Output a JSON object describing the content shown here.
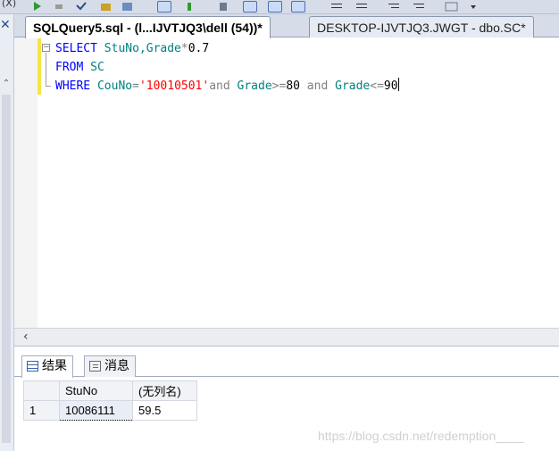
{
  "toolbar": {
    "fragment": "(X)"
  },
  "tabs": [
    {
      "label": "SQLQuery5.sql - (l...IJVTJQ3\\dell (54))*",
      "active": true
    },
    {
      "label": "DESKTOP-IJVTJQ3.JWGT - dbo.SC*",
      "active": false
    }
  ],
  "editor": {
    "line1": {
      "kw": "SELECT",
      "rest_a": " StuNo,Grade",
      "op": "*",
      "num": "0.7"
    },
    "line2": {
      "kw": "FROM",
      "rest": " SC"
    },
    "line3": {
      "kw": "WHERE",
      "id1": " CouNo",
      "eq": "=",
      "str": "'10010501'",
      "and1": "and",
      "id2": " Grade",
      "op2": ">=",
      "num2": "80",
      "and2": " and",
      "id3": " Grade",
      "op3": "<=",
      "num3": "90"
    }
  },
  "results": {
    "tabs": [
      {
        "label": "结果",
        "icon": "grid-icon",
        "active": true
      },
      {
        "label": "消息",
        "icon": "message-icon",
        "active": false
      }
    ],
    "columns": [
      "StuNo",
      "(无列名)"
    ],
    "rows": [
      {
        "num": "1",
        "cells": [
          "10086111",
          "59.5"
        ]
      }
    ]
  },
  "watermark": "https://blog.csdn.net/redemption____"
}
